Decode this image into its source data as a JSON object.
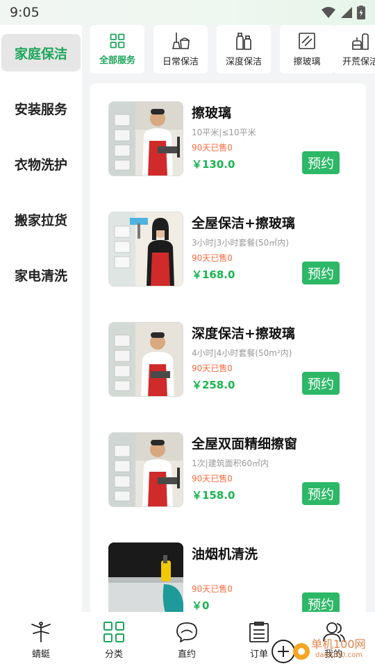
{
  "status_bar": {
    "time": "9:05",
    "icons": [
      "wifi-icon",
      "signal-icon",
      "battery-charging-icon"
    ]
  },
  "sidebar": {
    "items": [
      {
        "label": "家庭保洁",
        "active": true
      },
      {
        "label": "安装服务",
        "active": false
      },
      {
        "label": "衣物洗护",
        "active": false
      },
      {
        "label": "搬家拉货",
        "active": false
      },
      {
        "label": "家电清洗",
        "active": false
      }
    ]
  },
  "categories": [
    {
      "label": "全部服务",
      "icon": "grid-icon",
      "active": true
    },
    {
      "label": "日常保洁",
      "icon": "broom-bucket-icon",
      "active": false
    },
    {
      "label": "深度保洁",
      "icon": "spray-bottles-icon",
      "active": false
    },
    {
      "label": "擦玻璃",
      "icon": "window-glass-icon",
      "active": false
    },
    {
      "label": "开荒保洁",
      "icon": "cleaning-tools-icon",
      "active": false
    }
  ],
  "products": [
    {
      "title": "擦玻璃",
      "spec": "10平米|≤10平米",
      "sold": "90天已售0",
      "price": "￥130.0",
      "book": "预约",
      "image": "man-window-squeegee-photo"
    },
    {
      "title": "全屋保洁+擦玻璃",
      "spec": "3小时|3小时套餐(50㎡内)",
      "sold": "90天已售0",
      "price": "￥168.0",
      "book": "预约",
      "image": "woman-window-squeegee-photo"
    },
    {
      "title": "深度保洁+擦玻璃",
      "spec": "4小时|4小时套餐(50m²内)",
      "sold": "90天已售0",
      "price": "￥258.0",
      "book": "预约",
      "image": "man-window-squeegee-photo"
    },
    {
      "title": "全屋双面精细擦窗",
      "spec": "1次|建筑面积60㎡内",
      "sold": "90天已售0",
      "price": "￥158.0",
      "book": "预约",
      "image": "man-window-squeegee-photo"
    },
    {
      "title": "油烟机清洗",
      "spec": "",
      "sold": "90天已售0",
      "price": "￥0",
      "book": "预约",
      "image": "range-hood-cleaning-photo"
    }
  ],
  "bottom_nav": [
    {
      "label": "蜻蜓",
      "icon": "dragonfly-icon",
      "active": false
    },
    {
      "label": "分类",
      "icon": "category-grid-icon",
      "active": true
    },
    {
      "label": "直约",
      "icon": "chat-bubble-icon",
      "active": false
    },
    {
      "label": "订单",
      "icon": "order-list-icon",
      "active": false
    },
    {
      "label": "我的",
      "icon": "user-profile-icon",
      "active": false
    }
  ],
  "watermark": {
    "text1": "单机100网",
    "text2": "danji100.com"
  },
  "colors": {
    "accent": "#1aa55a",
    "button": "#2cb867",
    "price": "#19b54f",
    "sold": "#ff6a3d",
    "spec": "#999999"
  }
}
